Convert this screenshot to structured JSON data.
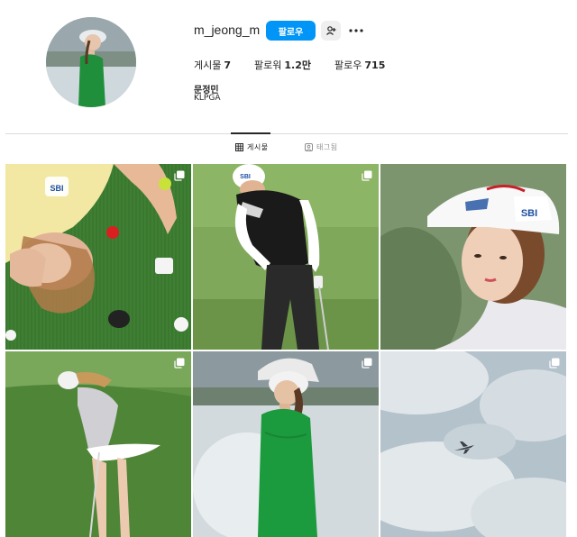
{
  "profile": {
    "username": "m_jeong_m",
    "follow_label": "팔로우",
    "stats": [
      {
        "label": "게시물",
        "value": "7"
      },
      {
        "label": "팔로워",
        "value": "1.2만"
      },
      {
        "label": "팔로우",
        "value": "715"
      }
    ],
    "full_name": "문정민",
    "bio": "KLPGA",
    "avatar_icon": "profile-photo"
  },
  "tabs": [
    {
      "label": "게시물",
      "icon": "grid-icon",
      "active": true
    },
    {
      "label": "태그됨",
      "icon": "tagged-icon",
      "active": false
    }
  ],
  "posts": [
    {
      "subject": "golfer lying on grass with golf balls",
      "multi": true
    },
    {
      "subject": "golfer swinging club in vest",
      "multi": true
    },
    {
      "subject": "golfer portrait with white cap",
      "multi": false
    },
    {
      "subject": "golfer follow-through swing on course",
      "multi": true
    },
    {
      "subject": "golfer in green top and bucket hat",
      "multi": true
    },
    {
      "subject": "airplane in cloudy sky",
      "multi": true
    }
  ],
  "colors": {
    "accent": "#0095f6",
    "text": "#262626",
    "muted": "#8e8e8e",
    "divider": "#dbdbdb"
  }
}
